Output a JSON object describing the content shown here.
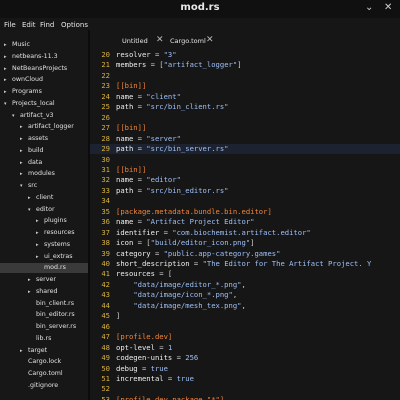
{
  "window": {
    "title": "mod.rs",
    "minimize": "⌄",
    "close": "✕"
  },
  "menu": [
    "File",
    "Edit",
    "Find",
    "Options"
  ],
  "tree": [
    {
      "label": "Music",
      "arrow": "▸",
      "depth": 0
    },
    {
      "label": "netbeans-11.3",
      "arrow": "▸",
      "depth": 0
    },
    {
      "label": "NetBeansProjects",
      "arrow": "▸",
      "depth": 0
    },
    {
      "label": "ownCloud",
      "arrow": "▸",
      "depth": 0
    },
    {
      "label": "Programs",
      "arrow": "▸",
      "depth": 0
    },
    {
      "label": "Projects_local",
      "arrow": "▾",
      "depth": 0
    },
    {
      "label": "artifact_v3",
      "arrow": "▾",
      "depth": 1
    },
    {
      "label": "artifact_logger",
      "arrow": "▸",
      "depth": 2
    },
    {
      "label": "assets",
      "arrow": "▸",
      "depth": 2
    },
    {
      "label": "build",
      "arrow": "▸",
      "depth": 2
    },
    {
      "label": "data",
      "arrow": "▸",
      "depth": 2
    },
    {
      "label": "modules",
      "arrow": "▸",
      "depth": 2
    },
    {
      "label": "src",
      "arrow": "▾",
      "depth": 2
    },
    {
      "label": "client",
      "arrow": "▸",
      "depth": 3
    },
    {
      "label": "editor",
      "arrow": "▾",
      "depth": 3
    },
    {
      "label": "plugins",
      "arrow": "▸",
      "depth": 4
    },
    {
      "label": "resources",
      "arrow": "▸",
      "depth": 4
    },
    {
      "label": "systems",
      "arrow": "▸",
      "depth": 4
    },
    {
      "label": "ui_extras",
      "arrow": "▸",
      "depth": 4
    },
    {
      "label": "mod.rs",
      "arrow": "",
      "depth": 4,
      "selected": true
    },
    {
      "label": "server",
      "arrow": "▸",
      "depth": 3
    },
    {
      "label": "shared",
      "arrow": "▸",
      "depth": 3
    },
    {
      "label": "bin_client.rs",
      "arrow": "",
      "depth": 3
    },
    {
      "label": "bin_editor.rs",
      "arrow": "",
      "depth": 3
    },
    {
      "label": "bin_server.rs",
      "arrow": "",
      "depth": 3
    },
    {
      "label": "lib.rs",
      "arrow": "",
      "depth": 3
    },
    {
      "label": "target",
      "arrow": "▸",
      "depth": 2
    },
    {
      "label": "Cargo.lock",
      "arrow": "",
      "depth": 2
    },
    {
      "label": "Cargo.toml",
      "arrow": "",
      "depth": 2
    },
    {
      "label": ".gitignore",
      "arrow": "",
      "depth": 2
    }
  ],
  "tabs": [
    {
      "label": "Untitled",
      "close": "✕"
    },
    {
      "label": "Cargo.toml",
      "close": "✕"
    }
  ],
  "code": [
    {
      "n": "20",
      "parts": [
        [
          "k",
          "resolver"
        ],
        [
          "eq",
          " = "
        ],
        [
          "str",
          "\"3\""
        ]
      ]
    },
    {
      "n": "21",
      "parts": [
        [
          "k",
          "members"
        ],
        [
          "eq",
          " = ["
        ],
        [
          "str",
          "\"artifact_logger\""
        ],
        [
          "eq",
          "]"
        ]
      ]
    },
    {
      "n": "22",
      "parts": []
    },
    {
      "n": "23",
      "parts": [
        [
          "sec",
          "[[bin]]"
        ]
      ]
    },
    {
      "n": "24",
      "parts": [
        [
          "k",
          "name"
        ],
        [
          "eq",
          " = "
        ],
        [
          "str",
          "\"client\""
        ]
      ]
    },
    {
      "n": "25",
      "parts": [
        [
          "k",
          "path"
        ],
        [
          "eq",
          " = "
        ],
        [
          "str",
          "\"src/bin_client.rs\""
        ]
      ]
    },
    {
      "n": "26",
      "parts": []
    },
    {
      "n": "27",
      "parts": [
        [
          "sec",
          "[[bin]]"
        ]
      ]
    },
    {
      "n": "28",
      "parts": [
        [
          "k",
          "name"
        ],
        [
          "eq",
          " = "
        ],
        [
          "str",
          "\"server\""
        ]
      ]
    },
    {
      "n": "29",
      "parts": [
        [
          "k",
          "path"
        ],
        [
          "eq",
          " = "
        ],
        [
          "str",
          "\"src/bin_server.rs\""
        ]
      ],
      "current": true
    },
    {
      "n": "30",
      "parts": []
    },
    {
      "n": "31",
      "parts": [
        [
          "sec",
          "[[bin]]"
        ]
      ]
    },
    {
      "n": "32",
      "parts": [
        [
          "k",
          "name"
        ],
        [
          "eq",
          " = "
        ],
        [
          "str",
          "\"editor\""
        ]
      ]
    },
    {
      "n": "33",
      "parts": [
        [
          "k",
          "path"
        ],
        [
          "eq",
          " = "
        ],
        [
          "str",
          "\"src/bin_editor.rs\""
        ]
      ]
    },
    {
      "n": "34",
      "parts": []
    },
    {
      "n": "35",
      "parts": [
        [
          "sec",
          "[package.metadata.bundle.bin.editor]"
        ]
      ]
    },
    {
      "n": "36",
      "parts": [
        [
          "k",
          "name"
        ],
        [
          "eq",
          " = "
        ],
        [
          "str",
          "\"Artifact Project Editor\""
        ]
      ]
    },
    {
      "n": "37",
      "parts": [
        [
          "k",
          "identifier"
        ],
        [
          "eq",
          " = "
        ],
        [
          "str",
          "\"com.biochemist.artifact.editor\""
        ]
      ]
    },
    {
      "n": "38",
      "parts": [
        [
          "k",
          "icon"
        ],
        [
          "eq",
          " = ["
        ],
        [
          "str",
          "\"build/editor_icon.png\""
        ],
        [
          "eq",
          "]"
        ]
      ]
    },
    {
      "n": "39",
      "parts": [
        [
          "k",
          "category"
        ],
        [
          "eq",
          " = "
        ],
        [
          "str",
          "\"public.app-category.games\""
        ]
      ]
    },
    {
      "n": "40",
      "parts": [
        [
          "k",
          "short_description"
        ],
        [
          "eq",
          " = "
        ],
        [
          "str",
          "\"The Editor for The Artifact Project. Y"
        ]
      ]
    },
    {
      "n": "41",
      "parts": [
        [
          "k",
          "resources"
        ],
        [
          "eq",
          " = ["
        ]
      ]
    },
    {
      "n": "42",
      "parts": [
        [
          "eq",
          "    "
        ],
        [
          "str",
          "\"data/image/editor_*.png\""
        ],
        [
          "eq",
          ","
        ]
      ]
    },
    {
      "n": "43",
      "parts": [
        [
          "eq",
          "    "
        ],
        [
          "str",
          "\"data/image/icon_*.png\""
        ],
        [
          "eq",
          ","
        ]
      ]
    },
    {
      "n": "44",
      "parts": [
        [
          "eq",
          "    "
        ],
        [
          "str",
          "\"data/image/mesh_tex.png\""
        ],
        [
          "eq",
          ","
        ]
      ]
    },
    {
      "n": "45",
      "parts": [
        [
          "eq",
          "]"
        ]
      ]
    },
    {
      "n": "46",
      "parts": []
    },
    {
      "n": "47",
      "parts": [
        [
          "sec",
          "[profile.dev]"
        ]
      ]
    },
    {
      "n": "48",
      "parts": [
        [
          "k",
          "opt-level"
        ],
        [
          "eq",
          " = "
        ],
        [
          "num",
          "1"
        ]
      ]
    },
    {
      "n": "49",
      "parts": [
        [
          "k",
          "codegen-units"
        ],
        [
          "eq",
          " = "
        ],
        [
          "num",
          "256"
        ]
      ]
    },
    {
      "n": "50",
      "parts": [
        [
          "k",
          "debug"
        ],
        [
          "eq",
          " = "
        ],
        [
          "num",
          "true"
        ]
      ]
    },
    {
      "n": "51",
      "parts": [
        [
          "k",
          "incremental"
        ],
        [
          "eq",
          " = "
        ],
        [
          "num",
          "true"
        ]
      ]
    },
    {
      "n": "52",
      "parts": []
    },
    {
      "n": "53",
      "parts": [
        [
          "sec",
          "[profile.dev.package.\"*\"]"
        ]
      ]
    }
  ]
}
